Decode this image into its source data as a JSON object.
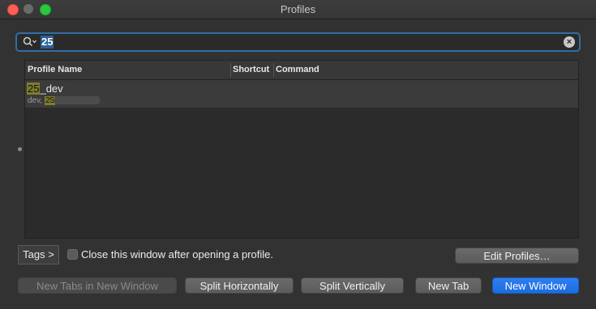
{
  "window": {
    "title": "Profiles"
  },
  "search": {
    "value": "25"
  },
  "table": {
    "headers": [
      "Profile Name",
      "Shortcut",
      "Command"
    ],
    "rows": [
      {
        "name_highlight": "25",
        "name_rest": "_dev",
        "tags_prefix": "dev, ",
        "tags_highlight": "25"
      }
    ]
  },
  "controls": {
    "tags_button": "Tags >",
    "close_checkbox_label": "Close this window after opening a profile.",
    "edit_profiles": "Edit Profiles…"
  },
  "actions": {
    "new_tabs_in_new_window": "New Tabs in New Window",
    "split_horizontally": "Split Horizontally",
    "split_vertically": "Split Vertically",
    "new_tab": "New Tab",
    "new_window": "New Window"
  },
  "colors": {
    "accent": "#1a6ce0",
    "highlight": "#7f7d2e",
    "search_focus": "#2f6ea5"
  }
}
